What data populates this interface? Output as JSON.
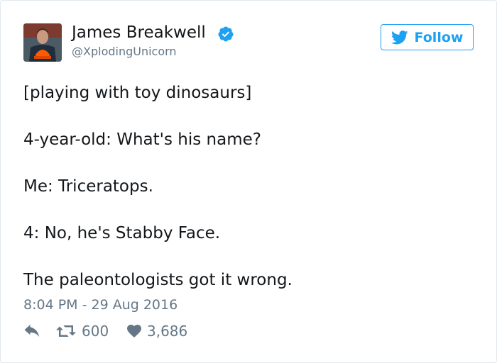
{
  "tweet": {
    "author_name": "James Breakwell",
    "author_handle": "@XplodingUnicorn",
    "verified_icon": "verified-badge-icon",
    "follow_label": "Follow",
    "lines": [
      "[playing with toy dinosaurs]",
      "4-year-old: What's his name?",
      "Me: Triceratops.",
      "4: No, he's Stabby Face.",
      "The paleontologists got it wrong."
    ],
    "timestamp": "8:04 PM - 29 Aug 2016",
    "retweets": "600",
    "likes": "3,686"
  },
  "colors": {
    "accent": "#1da1f2",
    "muted": "#657786",
    "text": "#14171a",
    "border": "#e1e8ed"
  }
}
